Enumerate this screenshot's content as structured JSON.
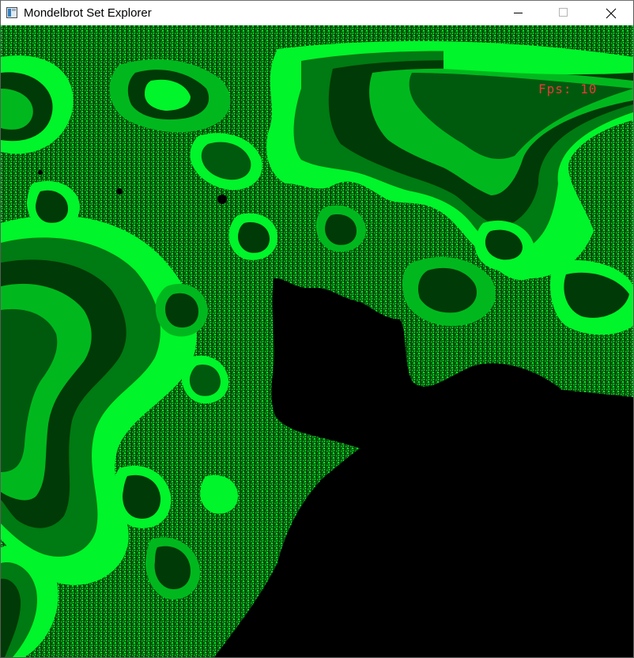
{
  "window": {
    "title": "Mondelbrot Set Explorer",
    "controls": [
      "minimize-icon",
      "maximize-icon",
      "close-icon"
    ]
  },
  "canvas": {
    "fps_label": "Fps: 10",
    "palette": {
      "background": "#000000",
      "dark_green": "#003a06",
      "mid_green": "#007a12",
      "bright_green": "#00b81e",
      "neon_green": "#00f52a",
      "fps_red": "#e53b36"
    }
  }
}
